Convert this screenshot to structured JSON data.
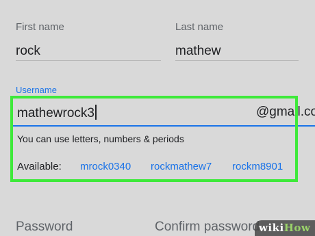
{
  "form": {
    "first_name": {
      "label": "First name",
      "value": "rock"
    },
    "last_name": {
      "label": "Last name",
      "value": "mathew"
    },
    "username": {
      "label": "Username",
      "value": "mathewrock3",
      "domain_suffix": "@gmail.com",
      "helper_text": "You can use letters, numbers & periods",
      "available_label": "Available:",
      "suggestions": [
        "mrock0340",
        "rockmathew7",
        "rockm8901"
      ]
    },
    "password": {
      "label": "Password"
    },
    "confirm_password": {
      "label": "Confirm password"
    }
  },
  "watermark": {
    "prefix": "wiki",
    "suffix": "How"
  },
  "colors": {
    "background": "#d9d9d9",
    "accent": "#1a73e8",
    "highlight": "#3ee93a"
  }
}
